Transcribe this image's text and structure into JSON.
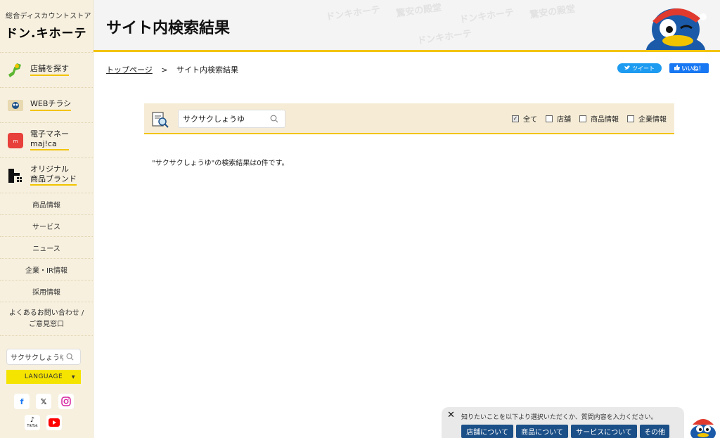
{
  "sidebar": {
    "logo_tag": "総合ディスカウントストア",
    "logo_main": "ドン.キホーテ",
    "features": [
      {
        "label": "店舗を探す"
      },
      {
        "label": "WEBチラシ"
      },
      {
        "label_line1": "電子マネー",
        "label_line2": "maj!ca"
      },
      {
        "label_line1": "オリジナル",
        "label_line2": "商品ブランド"
      }
    ],
    "links": [
      "商品情報",
      "サービス",
      "ニュース",
      "企業・IR情報",
      "採用情報"
    ],
    "contact_line1": "よくあるお問い合わせ /",
    "contact_line2": "ご意見窓口",
    "search_value": "サクサクしょうゆ",
    "language_label": "LANGUAGE",
    "tiktok_label": "TikTok"
  },
  "header": {
    "title": "サイト内検索結果",
    "watermarks": [
      "ドンキホーテ",
      "驚安の殿堂",
      "ドンキホーテ",
      "驚安の殿堂",
      "ドンキホーテ"
    ]
  },
  "breadcrumb": {
    "home": "トップページ",
    "separator": ">",
    "current": "サイト内検索結果"
  },
  "share": {
    "tweet": "ツイート",
    "like": "いいね！"
  },
  "search_panel": {
    "query": "サクサクしょうゆ",
    "filters": [
      {
        "label": "全て",
        "checked": true
      },
      {
        "label": "店舗",
        "checked": false
      },
      {
        "label": "商品情報",
        "checked": false
      },
      {
        "label": "企業情報",
        "checked": false
      }
    ]
  },
  "result": {
    "message": "\"サクサクしょうゆ\"の検索結果は0件です。"
  },
  "chat": {
    "prompt": "知りたいことを以下より選択いただくか、質問内容を入力ください。",
    "buttons": [
      "店舗について",
      "商品について",
      "サービスについて",
      "その他"
    ]
  },
  "colors": {
    "accent_yellow": "#f2c400",
    "sidebar_bg": "#f7f0df",
    "chat_button": "#1b4f87",
    "tweet_blue": "#1d9bf0",
    "facebook_blue": "#1877f2"
  }
}
